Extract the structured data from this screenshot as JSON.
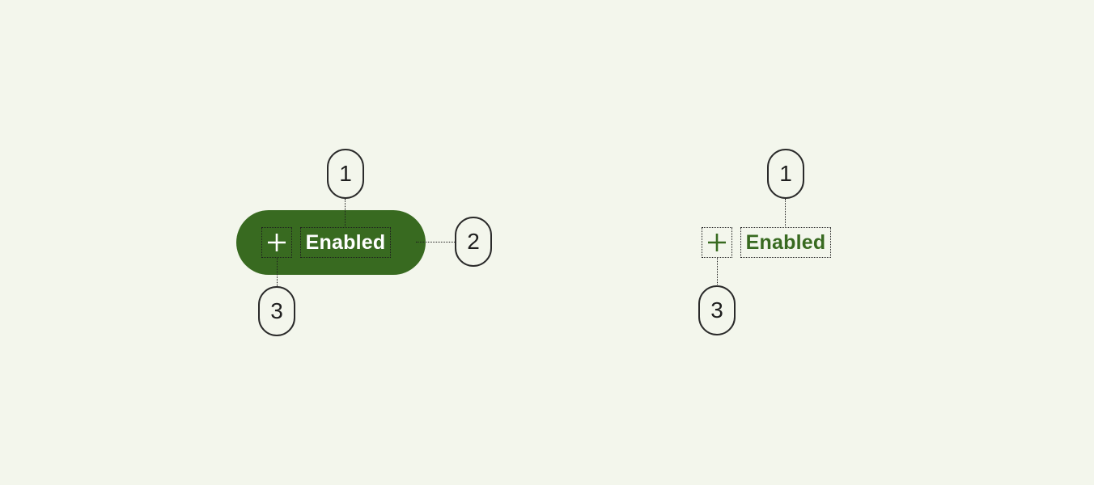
{
  "filled_button": {
    "label": "Enabled",
    "icon": "plus-icon"
  },
  "text_button": {
    "label": "Enabled",
    "icon": "plus-icon"
  },
  "callouts": {
    "label_text": "1",
    "container": "2",
    "icon": "3"
  },
  "colors": {
    "background": "#f3f6ec",
    "primary": "#386a20",
    "on_primary": "#ffffff",
    "outline": "#2a2a2a"
  }
}
